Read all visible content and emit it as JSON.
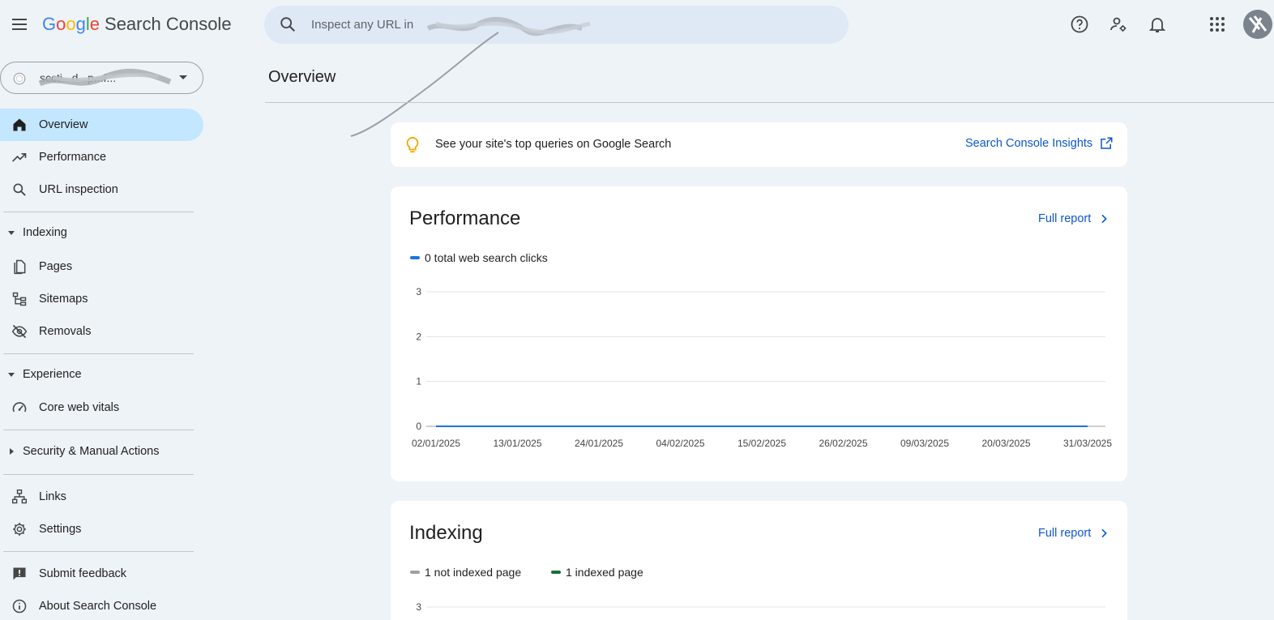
{
  "header": {
    "logo": [
      "G",
      "o",
      "o",
      "g",
      "l",
      "e"
    ],
    "product": "Search Console",
    "search_placeholder": "Inspect any URL in "
  },
  "property": {
    "name": "sccti...d...p...f..."
  },
  "sidebar": {
    "items_top": [
      {
        "label": "Overview",
        "icon": "home-icon",
        "active": true
      },
      {
        "label": "Performance",
        "icon": "trending-up-icon"
      },
      {
        "label": "URL inspection",
        "icon": "search-icon"
      }
    ],
    "indexing": {
      "label": "Indexing",
      "items": [
        {
          "label": "Pages",
          "icon": "pages-icon"
        },
        {
          "label": "Sitemaps",
          "icon": "sitemap-icon"
        },
        {
          "label": "Removals",
          "icon": "visibility-off-icon"
        }
      ]
    },
    "experience": {
      "label": "Experience",
      "items": [
        {
          "label": "Core web vitals",
          "icon": "speed-icon"
        }
      ]
    },
    "security": {
      "label": "Security & Manual Actions"
    },
    "items_bottom": [
      {
        "label": "Links",
        "icon": "links-icon"
      },
      {
        "label": "Settings",
        "icon": "gear-icon"
      }
    ],
    "footer_items": [
      {
        "label": "Submit feedback",
        "icon": "feedback-icon"
      },
      {
        "label": "About Search Console",
        "icon": "info-icon"
      }
    ]
  },
  "main": {
    "title": "Overview",
    "insight": {
      "text": "See your site's top queries on Google Search",
      "link": "Search Console Insights"
    },
    "performance": {
      "title": "Performance",
      "link": "Full report",
      "legend": "0 total web search clicks",
      "color": "#1a73e8"
    },
    "indexing": {
      "title": "Indexing",
      "link": "Full report",
      "legend_not_indexed": "1 not indexed page",
      "legend_indexed": "1 indexed page",
      "color_not_indexed": "#9aa0a6",
      "color_indexed": "#137333",
      "y_top_tick": "3"
    }
  },
  "chart_data": {
    "type": "line",
    "title": "",
    "xlabel": "",
    "ylabel": "",
    "ylim": [
      0,
      3
    ],
    "y_ticks": [
      "0",
      "1",
      "2",
      "3"
    ],
    "x_ticks": [
      "02/01/2025",
      "13/01/2025",
      "24/01/2025",
      "04/02/2025",
      "15/02/2025",
      "26/02/2025",
      "09/03/2025",
      "20/03/2025",
      "31/03/2025"
    ],
    "grid": true,
    "series": [
      {
        "name": "0 total web search clicks",
        "x": [
          "02/01/2025",
          "31/03/2025"
        ],
        "values": [
          0,
          0
        ]
      }
    ]
  }
}
